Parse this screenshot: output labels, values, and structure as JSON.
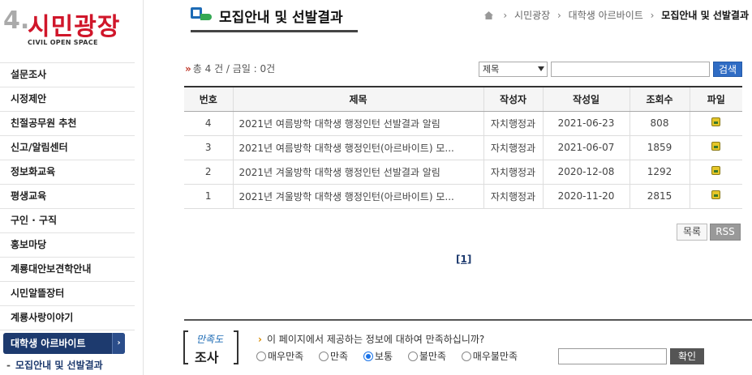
{
  "logo": {
    "number": "4.",
    "name": "시민광장",
    "subtitle": "CIVIL OPEN SPACE"
  },
  "sidebar": {
    "items": [
      {
        "label": "설문조사"
      },
      {
        "label": "시정제안"
      },
      {
        "label": "친절공무원 추천"
      },
      {
        "label": "신고/알림센터"
      },
      {
        "label": "정보화교육"
      },
      {
        "label": "평생교육"
      },
      {
        "label": "구인 · 구직"
      },
      {
        "label": "홍보마당"
      },
      {
        "label": "계룡대안보견학안내"
      },
      {
        "label": "시민알뜰장터"
      },
      {
        "label": "계룡사랑이야기"
      },
      {
        "label": "대학생 아르바이트",
        "active": true
      }
    ],
    "submenu": {
      "label": "모집안내 및 선발결과"
    }
  },
  "header": {
    "title": "모집안내 및 선발결과",
    "breadcrumb": [
      "시민광장",
      "대학생 아르바이트",
      "모집안내 및 선발결과"
    ]
  },
  "info": {
    "count_text": "총 4 건 / 금일 : 0건",
    "search_select": "제목",
    "search_button": "검색"
  },
  "table": {
    "headers": [
      "번호",
      "제목",
      "작성자",
      "작성일",
      "조회수",
      "파일"
    ],
    "rows": [
      {
        "no": "4",
        "title": "2021년 여름방학 대학생 행정인턴 선발결과 알림",
        "author": "자치행정과",
        "date": "2021-06-23",
        "views": "808"
      },
      {
        "no": "3",
        "title": "2021년 여름방학 대학생 행정인턴(아르바이트) 모...",
        "author": "자치행정과",
        "date": "2021-06-07",
        "views": "1859"
      },
      {
        "no": "2",
        "title": "2021년 겨울방학 대학생 행정인턴 선발결과 알림",
        "author": "자치행정과",
        "date": "2020-12-08",
        "views": "1292"
      },
      {
        "no": "1",
        "title": "2021년 겨울방학 대학생 행정인턴(아르바이트) 모...",
        "author": "자치행정과",
        "date": "2020-11-20",
        "views": "2815"
      }
    ]
  },
  "buttons": {
    "list": "목록",
    "rss": "RSS"
  },
  "pager": {
    "current": "[1]"
  },
  "survey": {
    "logo_top": "만족도",
    "logo_bottom": "조사",
    "question": "이 페이지에서 제공하는 정보에 대하여 만족하십니까?",
    "options": [
      {
        "label": "매우만족",
        "checked": false
      },
      {
        "label": "만족",
        "checked": false
      },
      {
        "label": "보통",
        "checked": true
      },
      {
        "label": "불만족",
        "checked": false
      },
      {
        "label": "매우불만족",
        "checked": false
      }
    ],
    "submit": "확인"
  },
  "colors": {
    "accent": "#1d3a6e",
    "search_button": "#2f6cc4",
    "logo_red": "#d0162a"
  }
}
